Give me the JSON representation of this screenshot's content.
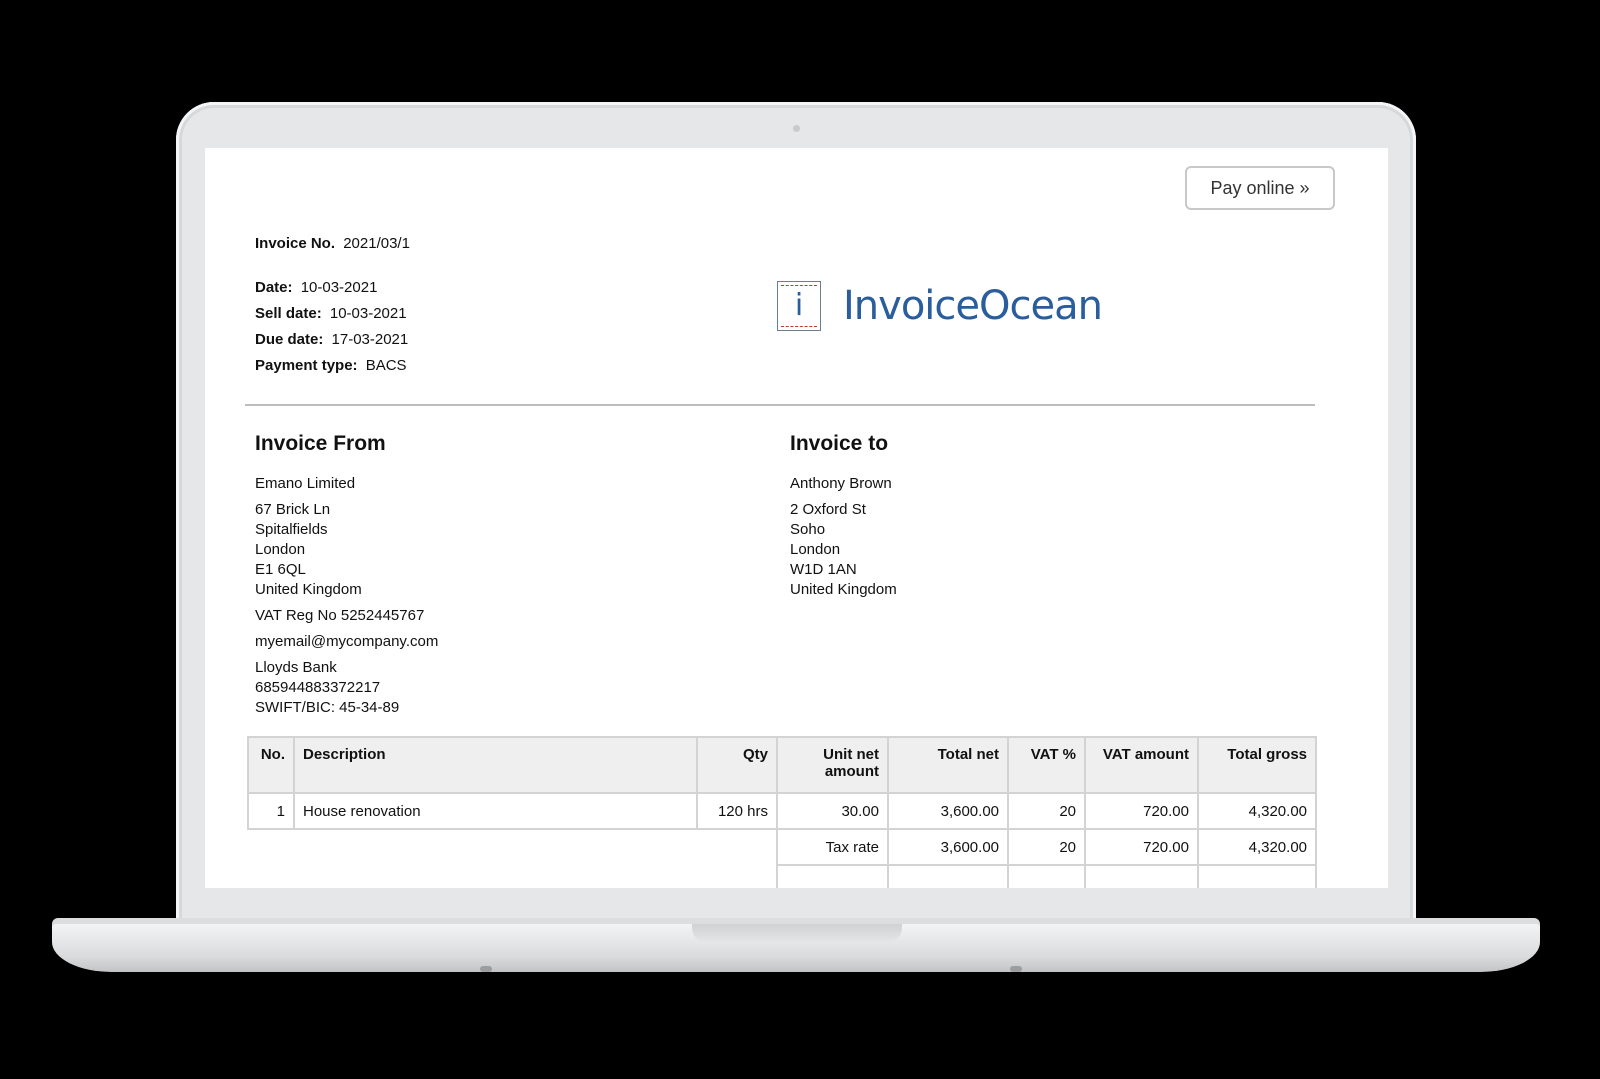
{
  "pay_button": "Pay online »",
  "invoice": {
    "number_label": "Invoice No.",
    "number": "2021/03/1",
    "date_label": "Date:",
    "date": "10-03-2021",
    "sell_date_label": "Sell date:",
    "sell_date": "10-03-2021",
    "due_date_label": "Due date:",
    "due_date": "17-03-2021",
    "payment_type_label": "Payment type:",
    "payment_type": "BACS"
  },
  "logo": {
    "glyph": "i",
    "name": "InvoiceOcean",
    "color": "#2a5d9b"
  },
  "from": {
    "heading": "Invoice From",
    "company": "Emano Limited",
    "address": [
      "67 Brick Ln",
      "Spitalfields",
      "London",
      "E1 6QL",
      "United Kingdom"
    ],
    "vat": "VAT Reg No 5252445767",
    "email": "myemail@mycompany.com",
    "bank": [
      "Lloyds Bank",
      "685944883372217",
      "SWIFT/BIC: 45-34-89"
    ]
  },
  "to": {
    "heading": "Invoice to",
    "name": "Anthony Brown",
    "address": [
      "2 Oxford St",
      "Soho",
      "London",
      "W1D 1AN",
      "United Kingdom"
    ]
  },
  "table": {
    "headers": {
      "no": "No.",
      "description": "Description",
      "qty": "Qty",
      "unit_net_1": "Unit net",
      "unit_net_2": "amount",
      "total_net": "Total net",
      "vat_pct": "VAT %",
      "vat_amount": "VAT amount",
      "total_gross": "Total gross"
    },
    "rows": [
      {
        "no": "1",
        "description": "House renovation",
        "qty": "120 hrs",
        "unit_net": "30.00",
        "total_net": "3,600.00",
        "vat_pct": "20",
        "vat_amount": "720.00",
        "total_gross": "4,320.00"
      }
    ],
    "tax_rate": {
      "label": "Tax rate",
      "total_net": "3,600.00",
      "vat_pct": "20",
      "vat_amount": "720.00",
      "total_gross": "4,320.00"
    }
  }
}
